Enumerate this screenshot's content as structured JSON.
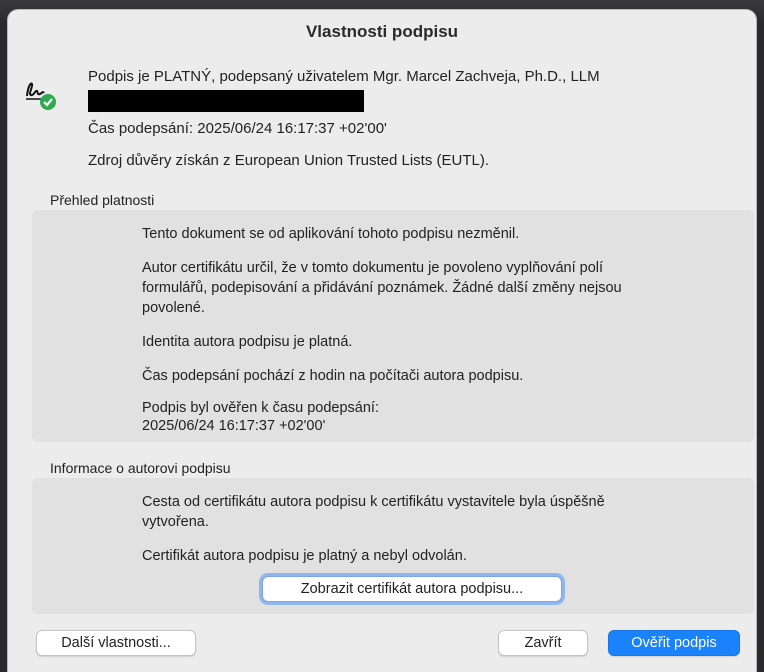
{
  "dialog": {
    "title": "Vlastnosti podpisu"
  },
  "summary": {
    "status": "Podpis je PLATNÝ, podepsaný uživatelem Mgr. Marcel Zachveja, Ph.D., LLM",
    "signing_time": "Čas podepsání:  2025/06/24 16:17:37 +02'00'",
    "trust_source": "Zdroj důvěry získán z European Union Trusted Lists (EUTL)."
  },
  "validity": {
    "label": "Přehled platnosti",
    "items": [
      "Tento dokument se od aplikování tohoto podpisu nezměnil.",
      "Autor certifikátu určil, že v tomto dokumentu je povoleno vyplňování polí",
      "formulářů, podepisování a přidávání poznámek. Žádné další změny nejsou",
      "povolené.",
      "Identita autora podpisu je platná.",
      "Čas podepsání pochází z hodin na počítači autora podpisu.",
      "Podpis byl ověřen k času podepsání:",
      "2025/06/24 16:17:37 +02'00'"
    ]
  },
  "signer_info": {
    "label": "Informace o autorovi podpisu",
    "items": [
      "Cesta od certifikátu autora podpisu k certifikátu vystavitele byla úspěšně",
      "vytvořena.",
      "Certifikát autora podpisu je platný a nebyl odvolán."
    ],
    "show_cert_button": "Zobrazit certifikát autora podpisu..."
  },
  "footer": {
    "more_props_button": "Další vlastnosti...",
    "close_button": "Zavřít",
    "verify_button": "Ověřit podpis"
  },
  "colors": {
    "accent": "#1a82fb",
    "valid_green": "#2fa84f"
  },
  "icons": {
    "signature": "signature-valid-icon"
  }
}
